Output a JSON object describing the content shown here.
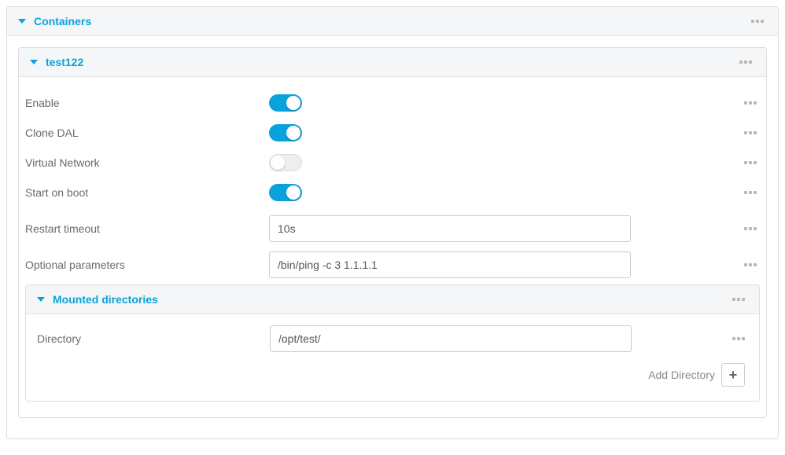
{
  "containers_panel": {
    "title": "Containers"
  },
  "container": {
    "title": "test122",
    "fields": {
      "enable": {
        "label": "Enable",
        "on": true
      },
      "clone_dal": {
        "label": "Clone DAL",
        "on": true
      },
      "virtual_network": {
        "label": "Virtual Network",
        "on": false
      },
      "start_on_boot": {
        "label": "Start on boot",
        "on": true
      },
      "restart_timeout": {
        "label": "Restart timeout",
        "value": "10s"
      },
      "optional_params": {
        "label": "Optional parameters",
        "value": "/bin/ping -c 3 1.1.1.1"
      }
    },
    "mounted": {
      "title": "Mounted directories",
      "directory_label": "Directory",
      "directory_value": "/opt/test/",
      "add_label": "Add Directory"
    }
  }
}
